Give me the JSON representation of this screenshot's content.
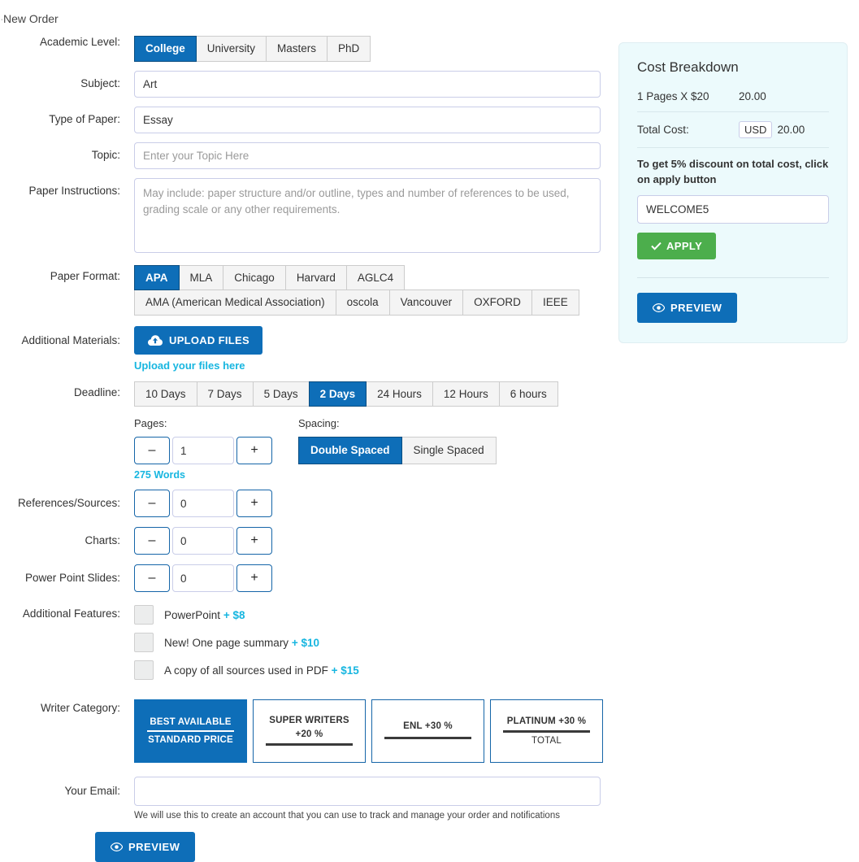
{
  "page": {
    "title": "New Order",
    "title_cut_prefix": "·"
  },
  "colors": {
    "accent_blue": "#0e6eb8",
    "active_border": "#0a4d80",
    "cyan": "#17b6e0",
    "green": "#4cae4c",
    "panel_bg": "#ecfafc"
  },
  "form": {
    "academic_level": {
      "label": "Academic Level:",
      "options": [
        "College",
        "University",
        "Masters",
        "PhD"
      ],
      "selected": "College"
    },
    "subject": {
      "label": "Subject:",
      "value": "Art",
      "placeholder": ""
    },
    "type_of_paper": {
      "label": "Type of Paper:",
      "value": "Essay",
      "placeholder": ""
    },
    "topic": {
      "label": "Topic:",
      "value": "",
      "placeholder": "Enter your Topic Here"
    },
    "paper_instructions": {
      "label": "Paper Instructions:",
      "value": "",
      "placeholder": "May include: paper structure and/or outline, types and number of references to be used, grading scale or any other requirements."
    },
    "paper_format": {
      "label": "Paper Format:",
      "row1": [
        "APA",
        "MLA",
        "Chicago",
        "Harvard",
        "AGLC4"
      ],
      "row2": [
        "AMA (American Medical Association)",
        "oscola",
        "Vancouver",
        "OXFORD",
        "IEEE"
      ],
      "selected": "APA"
    },
    "additional_materials": {
      "label": "Additional Materials:",
      "upload_label": "UPLOAD FILES",
      "upload_icon": "cloud-upload-icon",
      "hint": "Upload your files here"
    },
    "deadline": {
      "label": "Deadline:",
      "options": [
        "10 Days",
        "7 Days",
        "5 Days",
        "2 Days",
        "24 Hours",
        "12 Hours",
        "6 hours"
      ],
      "selected": "2 Days"
    },
    "pages": {
      "label": "Pages:",
      "value": "1",
      "minus": "–",
      "plus": "+",
      "words": "275 Words"
    },
    "spacing": {
      "label": "Spacing:",
      "options": [
        "Double Spaced",
        "Single Spaced"
      ],
      "selected": "Double Spaced"
    },
    "references": {
      "label": "References/Sources:",
      "value": "0",
      "minus": "–",
      "plus": "+"
    },
    "charts": {
      "label": "Charts:",
      "value": "0",
      "minus": "–",
      "plus": "+"
    },
    "slides": {
      "label": "Power Point Slides:",
      "value": "0",
      "minus": "–",
      "plus": "+"
    },
    "additional_features": {
      "label": "Additional Features:",
      "items": [
        {
          "text": "PowerPoint",
          "price": "+ $8",
          "checked": false
        },
        {
          "text": "New! One page summary",
          "price": "+ $10",
          "checked": false
        },
        {
          "text": "A copy of all sources used in PDF",
          "price": "+ $15",
          "checked": false
        }
      ]
    },
    "writer_category": {
      "label": "Writer Category:",
      "cards": [
        {
          "top": "BEST AVAILABLE",
          "bottom": "STANDARD PRICE",
          "active": true,
          "bottom_light": false
        },
        {
          "top": "SUPER WRITERS",
          "bottom": "+20 %",
          "active": false,
          "bottom_light": false,
          "rule_after_bottom": true
        },
        {
          "top": "ENL +30 %",
          "bottom": "",
          "active": false,
          "bottom_light": false,
          "rule_after_bottom": true
        },
        {
          "top": "PLATINUM +30 %",
          "bottom": "TOTAL",
          "active": false,
          "bottom_light": true
        }
      ]
    },
    "email": {
      "label": "Your Email:",
      "value": "",
      "placeholder": "",
      "note": "We will use this to create an account that you can use to track and manage your order and notifications"
    },
    "preview": {
      "label": "PREVIEW",
      "icon": "eye-icon"
    }
  },
  "cost_panel": {
    "title": "Cost Breakdown",
    "line_item_label": "1 Pages X $20",
    "line_item_value": "20.00",
    "total_label": "Total Cost:",
    "currency": "USD",
    "total_value": "20.00",
    "discount_note": "To get 5% discount on total cost, click on apply button",
    "promo_value": "WELCOME5",
    "promo_placeholder": "",
    "apply_label": "APPLY",
    "apply_icon": "check-icon",
    "preview_label": "PREVIEW",
    "preview_icon": "eye-icon"
  }
}
